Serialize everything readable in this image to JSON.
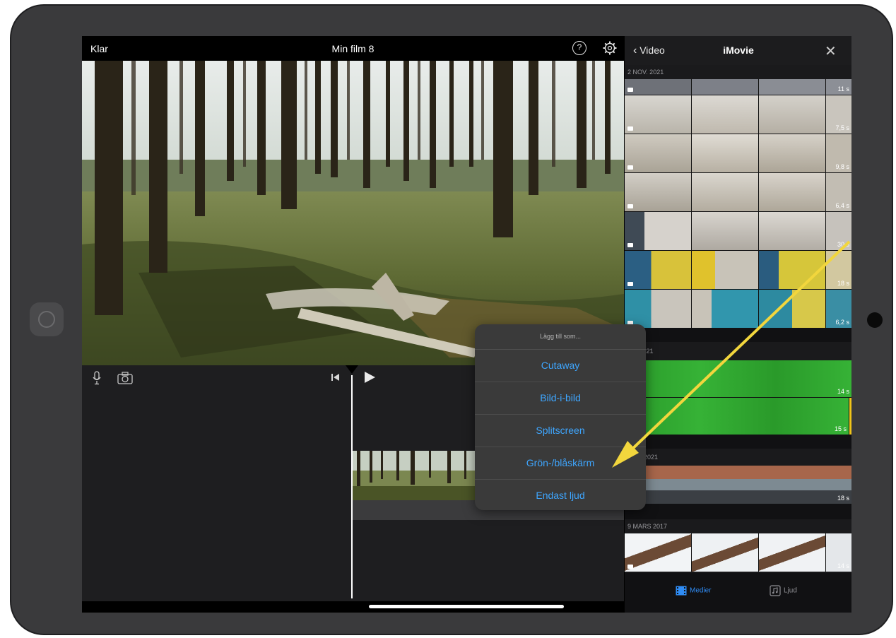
{
  "topbar": {
    "done": "Klar",
    "title": "Min film 8"
  },
  "browser": {
    "back": "Video",
    "title": "iMovie",
    "sections": [
      {
        "date": "2 NOV. 2021",
        "rows": [
          "11 s",
          "7,5 s",
          "9,8 s",
          "6,4 s",
          "30 s",
          "18 s",
          "6,2 s"
        ]
      },
      {
        "date": "… . 2021",
        "rows": [
          "14 s",
          "15 s"
        ]
      },
      {
        "date": "… R. 2021",
        "rows": [
          "18 s"
        ]
      },
      {
        "date": "9 MARS 2017",
        "rows": [
          "14 s"
        ]
      }
    ],
    "tabs": {
      "media": "Medier",
      "audio": "Ljud"
    }
  },
  "popover": {
    "header": "Lägg till som...",
    "items": [
      "Cutaway",
      "Bild-i-bild",
      "Splitscreen",
      "Grön-/blåskärm",
      "Endast ljud"
    ]
  },
  "colors": {
    "accent": "#3ea6ff",
    "tab_active": "#2f8cf5",
    "annotation_arrow": "#f2d63d",
    "greenscreen": "#2fa72f"
  }
}
